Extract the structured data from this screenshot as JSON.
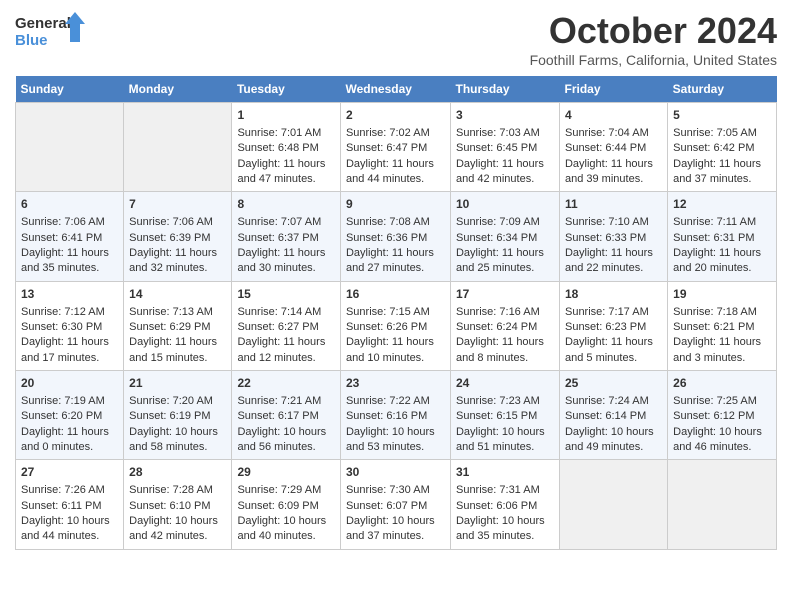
{
  "header": {
    "logo_line1": "General",
    "logo_line2": "Blue",
    "title": "October 2024",
    "location": "Foothill Farms, California, United States"
  },
  "columns": [
    "Sunday",
    "Monday",
    "Tuesday",
    "Wednesday",
    "Thursday",
    "Friday",
    "Saturday"
  ],
  "weeks": [
    [
      {
        "day": "",
        "empty": true
      },
      {
        "day": "",
        "empty": true
      },
      {
        "day": "1",
        "sunrise": "Sunrise: 7:01 AM",
        "sunset": "Sunset: 6:48 PM",
        "daylight": "Daylight: 11 hours and 47 minutes."
      },
      {
        "day": "2",
        "sunrise": "Sunrise: 7:02 AM",
        "sunset": "Sunset: 6:47 PM",
        "daylight": "Daylight: 11 hours and 44 minutes."
      },
      {
        "day": "3",
        "sunrise": "Sunrise: 7:03 AM",
        "sunset": "Sunset: 6:45 PM",
        "daylight": "Daylight: 11 hours and 42 minutes."
      },
      {
        "day": "4",
        "sunrise": "Sunrise: 7:04 AM",
        "sunset": "Sunset: 6:44 PM",
        "daylight": "Daylight: 11 hours and 39 minutes."
      },
      {
        "day": "5",
        "sunrise": "Sunrise: 7:05 AM",
        "sunset": "Sunset: 6:42 PM",
        "daylight": "Daylight: 11 hours and 37 minutes."
      }
    ],
    [
      {
        "day": "6",
        "sunrise": "Sunrise: 7:06 AM",
        "sunset": "Sunset: 6:41 PM",
        "daylight": "Daylight: 11 hours and 35 minutes."
      },
      {
        "day": "7",
        "sunrise": "Sunrise: 7:06 AM",
        "sunset": "Sunset: 6:39 PM",
        "daylight": "Daylight: 11 hours and 32 minutes."
      },
      {
        "day": "8",
        "sunrise": "Sunrise: 7:07 AM",
        "sunset": "Sunset: 6:37 PM",
        "daylight": "Daylight: 11 hours and 30 minutes."
      },
      {
        "day": "9",
        "sunrise": "Sunrise: 7:08 AM",
        "sunset": "Sunset: 6:36 PM",
        "daylight": "Daylight: 11 hours and 27 minutes."
      },
      {
        "day": "10",
        "sunrise": "Sunrise: 7:09 AM",
        "sunset": "Sunset: 6:34 PM",
        "daylight": "Daylight: 11 hours and 25 minutes."
      },
      {
        "day": "11",
        "sunrise": "Sunrise: 7:10 AM",
        "sunset": "Sunset: 6:33 PM",
        "daylight": "Daylight: 11 hours and 22 minutes."
      },
      {
        "day": "12",
        "sunrise": "Sunrise: 7:11 AM",
        "sunset": "Sunset: 6:31 PM",
        "daylight": "Daylight: 11 hours and 20 minutes."
      }
    ],
    [
      {
        "day": "13",
        "sunrise": "Sunrise: 7:12 AM",
        "sunset": "Sunset: 6:30 PM",
        "daylight": "Daylight: 11 hours and 17 minutes."
      },
      {
        "day": "14",
        "sunrise": "Sunrise: 7:13 AM",
        "sunset": "Sunset: 6:29 PM",
        "daylight": "Daylight: 11 hours and 15 minutes."
      },
      {
        "day": "15",
        "sunrise": "Sunrise: 7:14 AM",
        "sunset": "Sunset: 6:27 PM",
        "daylight": "Daylight: 11 hours and 12 minutes."
      },
      {
        "day": "16",
        "sunrise": "Sunrise: 7:15 AM",
        "sunset": "Sunset: 6:26 PM",
        "daylight": "Daylight: 11 hours and 10 minutes."
      },
      {
        "day": "17",
        "sunrise": "Sunrise: 7:16 AM",
        "sunset": "Sunset: 6:24 PM",
        "daylight": "Daylight: 11 hours and 8 minutes."
      },
      {
        "day": "18",
        "sunrise": "Sunrise: 7:17 AM",
        "sunset": "Sunset: 6:23 PM",
        "daylight": "Daylight: 11 hours and 5 minutes."
      },
      {
        "day": "19",
        "sunrise": "Sunrise: 7:18 AM",
        "sunset": "Sunset: 6:21 PM",
        "daylight": "Daylight: 11 hours and 3 minutes."
      }
    ],
    [
      {
        "day": "20",
        "sunrise": "Sunrise: 7:19 AM",
        "sunset": "Sunset: 6:20 PM",
        "daylight": "Daylight: 11 hours and 0 minutes."
      },
      {
        "day": "21",
        "sunrise": "Sunrise: 7:20 AM",
        "sunset": "Sunset: 6:19 PM",
        "daylight": "Daylight: 10 hours and 58 minutes."
      },
      {
        "day": "22",
        "sunrise": "Sunrise: 7:21 AM",
        "sunset": "Sunset: 6:17 PM",
        "daylight": "Daylight: 10 hours and 56 minutes."
      },
      {
        "day": "23",
        "sunrise": "Sunrise: 7:22 AM",
        "sunset": "Sunset: 6:16 PM",
        "daylight": "Daylight: 10 hours and 53 minutes."
      },
      {
        "day": "24",
        "sunrise": "Sunrise: 7:23 AM",
        "sunset": "Sunset: 6:15 PM",
        "daylight": "Daylight: 10 hours and 51 minutes."
      },
      {
        "day": "25",
        "sunrise": "Sunrise: 7:24 AM",
        "sunset": "Sunset: 6:14 PM",
        "daylight": "Daylight: 10 hours and 49 minutes."
      },
      {
        "day": "26",
        "sunrise": "Sunrise: 7:25 AM",
        "sunset": "Sunset: 6:12 PM",
        "daylight": "Daylight: 10 hours and 46 minutes."
      }
    ],
    [
      {
        "day": "27",
        "sunrise": "Sunrise: 7:26 AM",
        "sunset": "Sunset: 6:11 PM",
        "daylight": "Daylight: 10 hours and 44 minutes."
      },
      {
        "day": "28",
        "sunrise": "Sunrise: 7:28 AM",
        "sunset": "Sunset: 6:10 PM",
        "daylight": "Daylight: 10 hours and 42 minutes."
      },
      {
        "day": "29",
        "sunrise": "Sunrise: 7:29 AM",
        "sunset": "Sunset: 6:09 PM",
        "daylight": "Daylight: 10 hours and 40 minutes."
      },
      {
        "day": "30",
        "sunrise": "Sunrise: 7:30 AM",
        "sunset": "Sunset: 6:07 PM",
        "daylight": "Daylight: 10 hours and 37 minutes."
      },
      {
        "day": "31",
        "sunrise": "Sunrise: 7:31 AM",
        "sunset": "Sunset: 6:06 PM",
        "daylight": "Daylight: 10 hours and 35 minutes."
      },
      {
        "day": "",
        "empty": true
      },
      {
        "day": "",
        "empty": true
      }
    ]
  ]
}
